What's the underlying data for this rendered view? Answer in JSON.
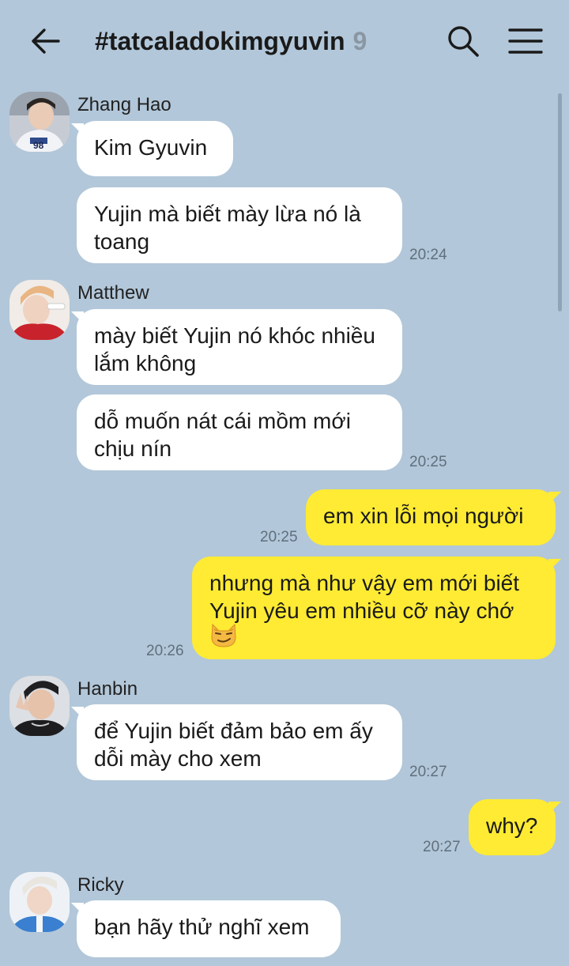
{
  "header": {
    "title": "#tatcaladokimgyuvin",
    "member_count": "9"
  },
  "colors": {
    "background": "#b2c7d9",
    "incoming_bubble": "#ffffff",
    "outgoing_bubble": "#ffeb33"
  },
  "icons": {
    "back": "back-arrow-icon",
    "search": "search-icon",
    "menu": "menu-icon"
  },
  "messages": [
    {
      "sender": "Zhang Hao",
      "text": "Kim Gyuvin"
    },
    {
      "text": "Yujin mà biết mày lừa nó là toang",
      "time": "20:24"
    },
    {
      "sender": "Matthew",
      "text": "mày biết Yujin nó khóc nhiều lắm không"
    },
    {
      "text": "dỗ muốn nát cái mồm mới chịu nín",
      "time": "20:25"
    },
    {
      "text": "em xin lỗi mọi người",
      "time": "20:25"
    },
    {
      "text": "nhưng mà như vậy em mới biết Yujin yêu em nhiều cỡ này chớ",
      "emoji": "smirking-cat-emoji",
      "time": "20:26"
    },
    {
      "sender": "Hanbin",
      "text": "để Yujin biết đảm bảo em ấy dỗi mày cho xem",
      "time": "20:27"
    },
    {
      "text": "why?",
      "time": "20:27"
    },
    {
      "sender": "Ricky",
      "text": "bạn hãy thử nghĩ xem"
    }
  ]
}
